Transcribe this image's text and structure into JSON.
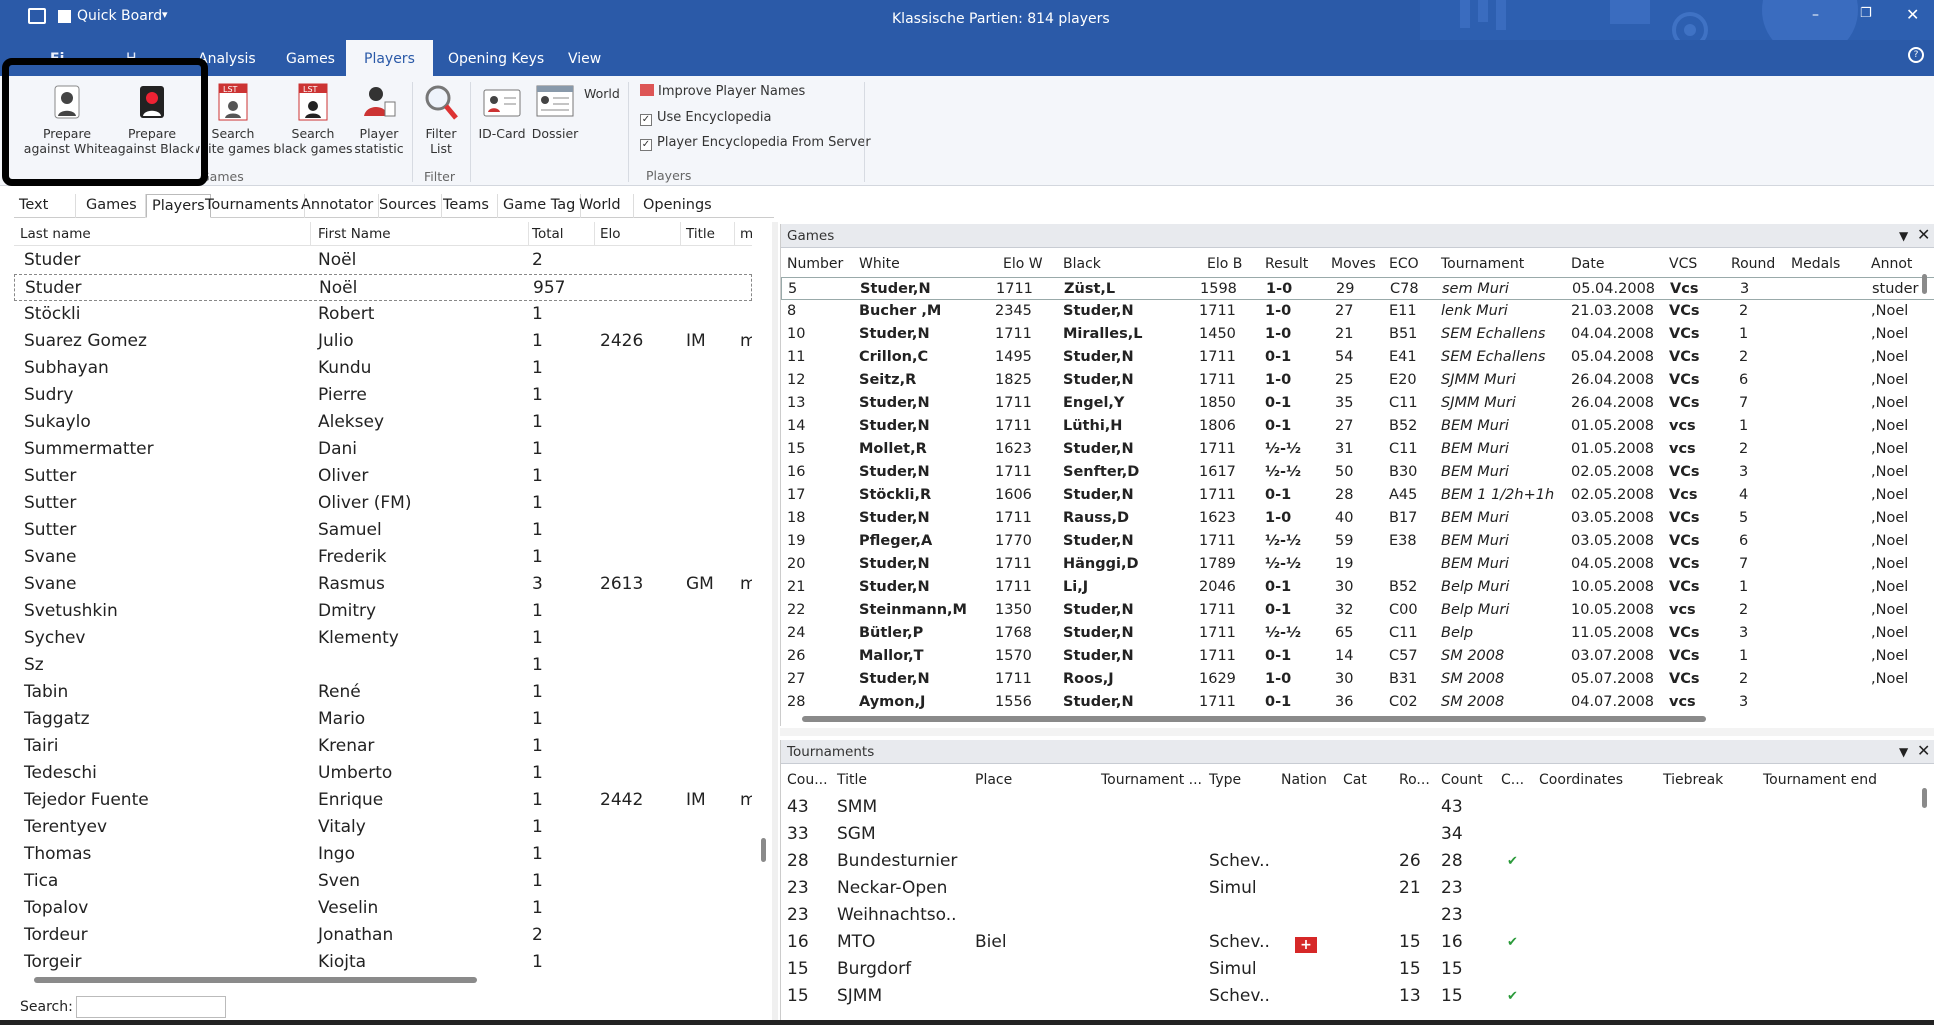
{
  "titlebar": {
    "app_label": "Quick Board",
    "title": "Klassische Partien:  814 players"
  },
  "ribbon_tabs": [
    "Analysis",
    "Games",
    "Players",
    "Opening Keys",
    "View"
  ],
  "ribbon": {
    "buttons": [
      {
        "line1": "Prepare",
        "line2": "against White"
      },
      {
        "line1": "Prepare",
        "line2": "against Black"
      },
      {
        "line1": "Search",
        "line2": "white games"
      },
      {
        "line1": "Search",
        "line2": "black games"
      },
      {
        "line1": "Player",
        "line2": "statistic"
      },
      {
        "line1": "Filter",
        "line2": "List"
      },
      {
        "line1": "ID-Card",
        "line2": ""
      },
      {
        "line1": "Dossier",
        "line2": ""
      }
    ],
    "world_label": "World",
    "group_games": "Games",
    "group_filter": "Filter",
    "group_players": "Players",
    "improve_names": "Improve Player Names",
    "use_encyclopedia": "Use Encyclopedia",
    "player_encyclopedia": "Player Encyclopedia From Server"
  },
  "subtabs": [
    "Text",
    "Games",
    "Players",
    "Tournaments",
    "Annotator",
    "Sources",
    "Teams",
    "Game Tag",
    "World",
    "Openings"
  ],
  "players": {
    "headers": [
      "Last name",
      "First Name",
      "Total",
      "Elo",
      "Title",
      "m"
    ],
    "rows": [
      [
        "Studer",
        "Noël",
        "2",
        "",
        "",
        ""
      ],
      [
        "Studer",
        "Noël",
        "957",
        "",
        "",
        ""
      ],
      [
        "Stöckli",
        "Robert",
        "1",
        "",
        "",
        ""
      ],
      [
        "Suarez Gomez",
        "Julio",
        "1",
        "2426",
        "IM",
        "m"
      ],
      [
        "Subhayan",
        "Kundu",
        "1",
        "",
        "",
        ""
      ],
      [
        "Sudry",
        "Pierre",
        "1",
        "",
        "",
        ""
      ],
      [
        "Sukaylo",
        "Aleksey",
        "1",
        "",
        "",
        ""
      ],
      [
        "Summermatter",
        "Dani",
        "1",
        "",
        "",
        ""
      ],
      [
        "Sutter",
        "Oliver",
        "1",
        "",
        "",
        ""
      ],
      [
        "Sutter",
        "Oliver (FM)",
        "1",
        "",
        "",
        ""
      ],
      [
        "Sutter",
        "Samuel",
        "1",
        "",
        "",
        ""
      ],
      [
        "Svane",
        "Frederik",
        "1",
        "",
        "",
        ""
      ],
      [
        "Svane",
        "Rasmus",
        "3",
        "2613",
        "GM",
        "m"
      ],
      [
        "Svetushkin",
        "Dmitry",
        "1",
        "",
        "",
        ""
      ],
      [
        "Sychev",
        "Klementy",
        "1",
        "",
        "",
        ""
      ],
      [
        "Sz",
        "",
        "1",
        "",
        "",
        ""
      ],
      [
        "Tabin",
        "René",
        "1",
        "",
        "",
        ""
      ],
      [
        "Taggatz",
        "Mario",
        "1",
        "",
        "",
        ""
      ],
      [
        "Tairi",
        "Krenar",
        "1",
        "",
        "",
        ""
      ],
      [
        "Tedeschi",
        "Umberto",
        "1",
        "",
        "",
        ""
      ],
      [
        "Tejedor Fuente",
        "Enrique",
        "1",
        "2442",
        "IM",
        "m"
      ],
      [
        "Terentyev",
        "Vitaly",
        "1",
        "",
        "",
        ""
      ],
      [
        "Thomas",
        "Ingo",
        "1",
        "",
        "",
        ""
      ],
      [
        "Tica",
        "Sven",
        "1",
        "",
        "",
        ""
      ],
      [
        "Topalov",
        "Veselin",
        "1",
        "",
        "",
        ""
      ],
      [
        "Tordeur",
        "Jonathan",
        "2",
        "",
        "",
        ""
      ],
      [
        "Torgeir",
        "Kiojta",
        "1",
        "",
        "",
        ""
      ]
    ],
    "search_label": "Search:"
  },
  "games": {
    "panel_title": "Games",
    "headers": [
      "Number",
      "White",
      "Elo W",
      "Black",
      "Elo B",
      "Result",
      "Moves",
      "ECO",
      "Tournament",
      "Date",
      "VCS",
      "Round",
      "Medals",
      "Annot"
    ],
    "rows": [
      [
        "5",
        "Studer,N",
        "1711",
        "Züst,L",
        "1598",
        "1-0",
        "29",
        "C78",
        "sem Muri",
        "05.04.2008",
        "Vcs",
        "3",
        "",
        "studer"
      ],
      [
        "8",
        "Bucher  ,M",
        "2345",
        "Studer,N",
        "1711",
        "1-0",
        "27",
        "E11",
        "lenk Muri",
        "21.03.2008",
        "VCs",
        "2",
        "",
        ",Noel"
      ],
      [
        "10",
        "Studer,N",
        "1711",
        "Miralles,L",
        "1450",
        "1-0",
        "21",
        "B51",
        "SEM Echallens",
        "04.04.2008",
        "VCs",
        "1",
        "",
        ",Noel"
      ],
      [
        "11",
        "Crillon,C",
        "1495",
        "Studer,N",
        "1711",
        "0-1",
        "54",
        "E41",
        "SEM Echallens",
        "05.04.2008",
        "VCs",
        "2",
        "",
        ",Noel"
      ],
      [
        "12",
        "Seitz,R",
        "1825",
        "Studer,N",
        "1711",
        "1-0",
        "25",
        "E20",
        "SJMM Muri",
        "26.04.2008",
        "VCs",
        "6",
        "",
        ",Noel"
      ],
      [
        "13",
        "Studer,N",
        "1711",
        "Engel,Y",
        "1850",
        "0-1",
        "35",
        "C11",
        "SJMM Muri",
        "26.04.2008",
        "VCs",
        "7",
        "",
        ",Noel"
      ],
      [
        "14",
        "Studer,N",
        "1711",
        "Lüthi,H",
        "1806",
        "0-1",
        "27",
        "B52",
        "BEM Muri",
        "01.05.2008",
        "vcs",
        "1",
        "",
        ",Noel"
      ],
      [
        "15",
        "Mollet,R",
        "1623",
        "Studer,N",
        "1711",
        "½-½",
        "31",
        "C11",
        "BEM Muri",
        "01.05.2008",
        "vcs",
        "2",
        "",
        ",Noel"
      ],
      [
        "16",
        "Studer,N",
        "1711",
        "Senfter,D",
        "1617",
        "½-½",
        "50",
        "B30",
        "BEM Muri",
        "02.05.2008",
        "VCs",
        "3",
        "",
        ",Noel"
      ],
      [
        "17",
        "Stöckli,R",
        "1606",
        "Studer,N",
        "1711",
        "0-1",
        "28",
        "A45",
        "BEM 1 1/2h+1h",
        "02.05.2008",
        "Vcs",
        "4",
        "",
        ",Noel"
      ],
      [
        "18",
        "Studer,N",
        "1711",
        "Rauss,D",
        "1623",
        "1-0",
        "40",
        "B17",
        "BEM Muri",
        "03.05.2008",
        "VCs",
        "5",
        "",
        ",Noel"
      ],
      [
        "19",
        "Pfleger,A",
        "1770",
        "Studer,N",
        "1711",
        "½-½",
        "59",
        "E38",
        "BEM Muri",
        "03.05.2008",
        "VCs",
        "6",
        "",
        ",Noel"
      ],
      [
        "20",
        "Studer,N",
        "1711",
        "Hänggi,D",
        "1789",
        "½-½",
        "19",
        "",
        "BEM Muri",
        "04.05.2008",
        "VCs",
        "7",
        "",
        ",Noel"
      ],
      [
        "21",
        "Studer,N",
        "1711",
        "Li,J",
        "2046",
        "0-1",
        "30",
        "B52",
        "Belp Muri",
        "10.05.2008",
        "VCs",
        "1",
        "",
        ",Noel"
      ],
      [
        "22",
        "Steinmann,M",
        "1350",
        "Studer,N",
        "1711",
        "0-1",
        "32",
        "C00",
        "Belp Muri",
        "10.05.2008",
        "vcs",
        "2",
        "",
        ",Noel"
      ],
      [
        "24",
        "Bütler,P",
        "1768",
        "Studer,N",
        "1711",
        "½-½",
        "65",
        "C11",
        "Belp",
        "11.05.2008",
        "VCs",
        "3",
        "",
        ",Noel"
      ],
      [
        "26",
        "Mallor,T",
        "1570",
        "Studer,N",
        "1711",
        "0-1",
        "14",
        "C57",
        "SM 2008",
        "03.07.2008",
        "VCs",
        "1",
        "",
        ",Noel"
      ],
      [
        "27",
        "Studer,N",
        "1711",
        "Roos,J",
        "1629",
        "1-0",
        "30",
        "B31",
        "SM 2008",
        "05.07.2008",
        "VCs",
        "2",
        "",
        ",Noel"
      ],
      [
        "28",
        "Aymon,J",
        "1556",
        "Studer,N",
        "1711",
        "0-1",
        "36",
        "C02",
        "SM 2008",
        "04.07.2008",
        "vcs",
        "3",
        "",
        ""
      ]
    ]
  },
  "tournaments": {
    "panel_title": "Tournaments",
    "headers": [
      "Cou...",
      "Title",
      "Place",
      "Tournament ...",
      "Type",
      "Nation",
      "Cat",
      "Ro...",
      "Count",
      "C...",
      "Coordinates",
      "Tiebreak",
      "Tournament end"
    ],
    "rows": [
      [
        "43",
        "SMM",
        "",
        "",
        "",
        "",
        "",
        "",
        "43",
        ""
      ],
      [
        "33",
        "SGM",
        "",
        "",
        "",
        "",
        "",
        "",
        "34",
        ""
      ],
      [
        "28",
        "Bundesturnier",
        "",
        "",
        "Schev..",
        "",
        "",
        "26",
        "28",
        "✔"
      ],
      [
        "23",
        "Neckar-Open",
        "",
        "",
        "Simul",
        "",
        "",
        "21",
        "23",
        ""
      ],
      [
        "23",
        "Weihnachtso..",
        "",
        "",
        "",
        "",
        "",
        "",
        "23",
        ""
      ],
      [
        "16",
        "MTO",
        "Biel",
        "",
        "Schev..",
        "CH",
        "",
        "15",
        "16",
        "✔"
      ],
      [
        "15",
        "Burgdorf",
        "",
        "",
        "Simul",
        "",
        "",
        "15",
        "15",
        ""
      ],
      [
        "15",
        "SJMM",
        "",
        "",
        "Schev..",
        "",
        "",
        "13",
        "15",
        "✔"
      ]
    ]
  }
}
